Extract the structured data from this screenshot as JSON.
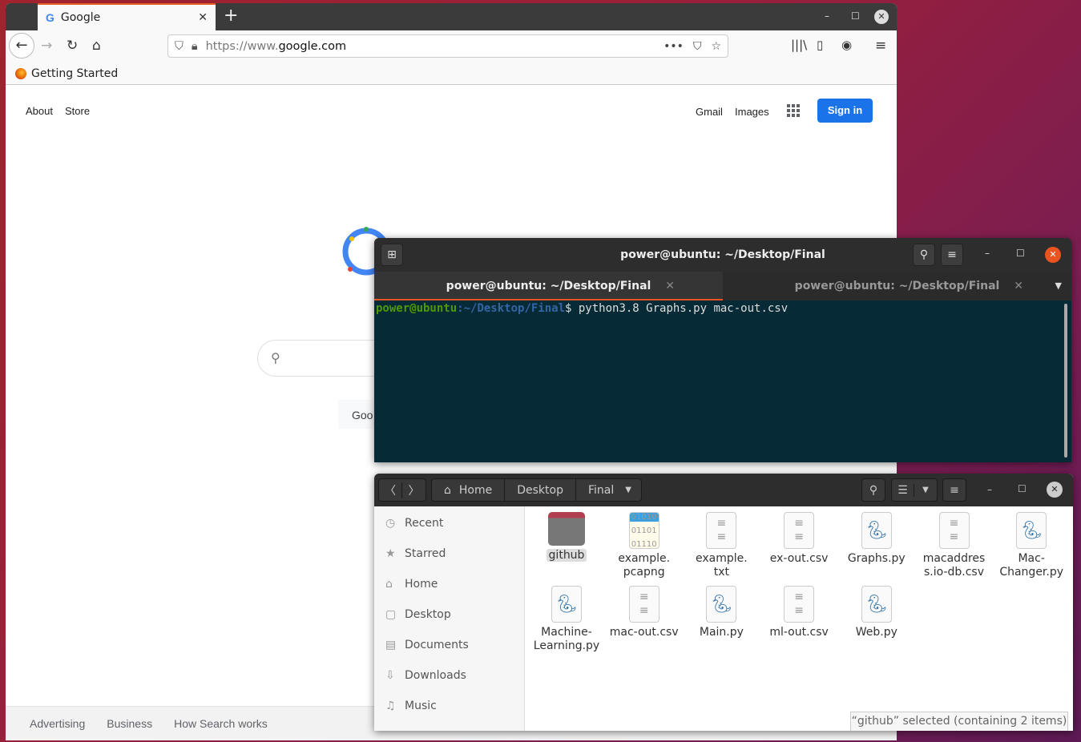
{
  "browser": {
    "tab_title": "Google",
    "url_prefix": "https://www.",
    "url_domain": "google.com",
    "bookmark": "Getting Started"
  },
  "google": {
    "about": "About",
    "store": "Store",
    "gmail": "Gmail",
    "images": "Images",
    "sign_in": "Sign in",
    "search_button": "Goo",
    "footer": [
      "Advertising",
      "Business",
      "How Search works"
    ]
  },
  "terminal": {
    "title": "power@ubuntu: ~/Desktop/Final",
    "tabs": [
      "power@ubuntu: ~/Desktop/Final",
      "power@ubuntu: ~/Desktop/Final"
    ],
    "prompt_user": "power@ubuntu",
    "prompt_path": ":~/Desktop/Final",
    "command": "$ python3.8 Graphs.py mac-out.csv"
  },
  "files": {
    "breadcrumb": [
      "Home",
      "Desktop",
      "Final"
    ],
    "sidebar": [
      "Recent",
      "Starred",
      "Home",
      "Desktop",
      "Documents",
      "Downloads",
      "Music"
    ],
    "items": [
      {
        "name": "github",
        "type": "folder"
      },
      {
        "name": "example.\npcapng",
        "type": "binary"
      },
      {
        "name": "example.\ntxt",
        "type": "text"
      },
      {
        "name": "ex-out.csv",
        "type": "text"
      },
      {
        "name": "Graphs.py",
        "type": "python"
      },
      {
        "name": "macaddres\ns.io-db.csv",
        "type": "text"
      },
      {
        "name": "Mac-\nChanger.py",
        "type": "python"
      },
      {
        "name": "Machine-\nLearning.py",
        "type": "python"
      },
      {
        "name": "mac-out.csv",
        "type": "text"
      },
      {
        "name": "Main.py",
        "type": "python"
      },
      {
        "name": "ml-out.csv",
        "type": "text"
      },
      {
        "name": "Web.py",
        "type": "python"
      }
    ],
    "status": "“github” selected  (containing 2 items)"
  },
  "colors": {
    "accent": "#e95420",
    "terminal_bg": "#062a36",
    "google_blue": "#1a73e8"
  }
}
